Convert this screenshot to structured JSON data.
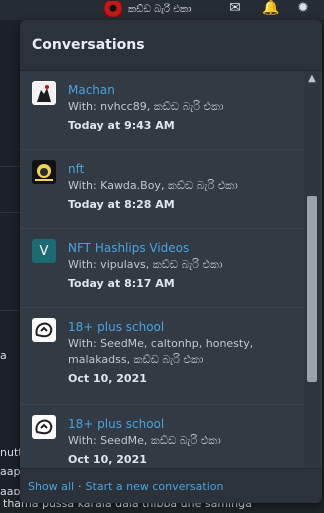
{
  "window": {
    "username": "කඩ්ඩ බැරි එකා"
  },
  "background": {
    "snippets": [
      "a",
      "nutta,",
      "aapul",
      "aapu",
      "thama pussa karala dala thibba une saminga"
    ]
  },
  "panel": {
    "title": "Conversations",
    "items": [
      {
        "title": "Machan",
        "with": "With: nvhcc89, කඩ්ඩ බැරි එකා",
        "date": "Today at 9:43 AM",
        "thumb": "shadow-figure-avatar"
      },
      {
        "title": "nft",
        "with": "With: Kawda.Boy, කඩ්ඩ බැරි එකා",
        "date": "Today at 8:28 AM",
        "thumb": "lion-avatar"
      },
      {
        "title": "NFT Hashlips Videos",
        "with": "With: vipulavs, කඩ්ඩ බැරි එකා",
        "date": "Today at 8:17 AM",
        "thumb": "letter-avatar-v",
        "letter": "V"
      },
      {
        "title": "18+ plus school",
        "with": "With: SeedMe, caltonhp, honesty, malakadss, කඩ්ඩ බැරි එකා",
        "date": "Oct 10, 2021",
        "thumb": "chat-app-logo"
      },
      {
        "title": "18+ plus school",
        "with": "With: SeedMe, කඩ්ඩ බැරි එකා",
        "date": "Oct 10, 2021",
        "thumb": "chat-app-logo"
      }
    ],
    "footer": {
      "show_all": "Show all",
      "separator": "·",
      "start_new": "Start a new conversation"
    }
  },
  "colors": {
    "accent": "#4aa3df",
    "panel_bg": "#303841",
    "header_bg": "#2b323a"
  }
}
